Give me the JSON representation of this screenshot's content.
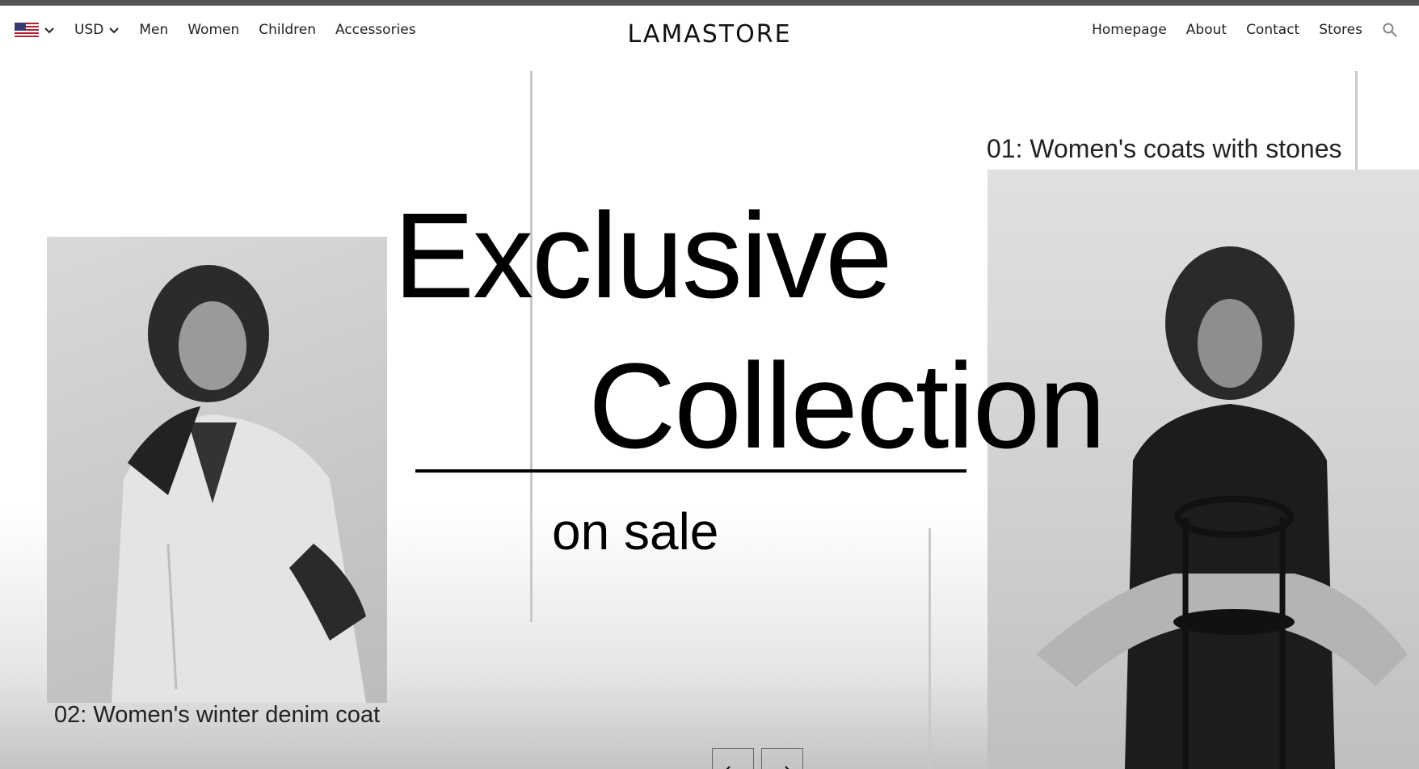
{
  "nav": {
    "language_icon": "us-flag-icon",
    "currency": "USD",
    "categories": [
      "Men",
      "Women",
      "Children",
      "Accessories"
    ],
    "brand": "LAMASTORE",
    "links": [
      "Homepage",
      "About",
      "Contact",
      "Stores"
    ],
    "search_icon": "search-icon"
  },
  "hero": {
    "title_line1": "Exclusive",
    "title_line2": "Collection",
    "subtitle": "on sale",
    "items": [
      {
        "caption": "02: Women's winter denim coat"
      },
      {
        "caption": "01: Women's coats with stones"
      }
    ],
    "prev_icon": "arrow-left-icon",
    "next_icon": "arrow-right-icon"
  },
  "colors": {
    "text": "#000000",
    "background": "#ffffff",
    "divider": "#c9c9c9"
  }
}
